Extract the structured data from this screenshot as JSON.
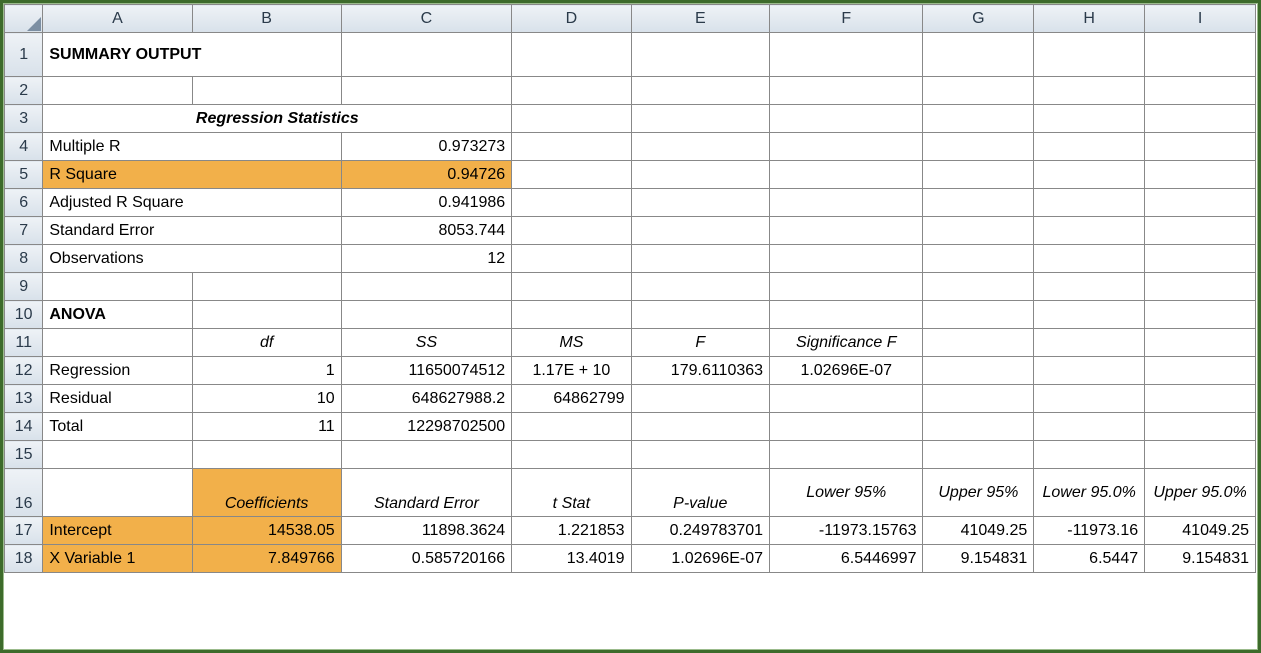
{
  "columns": [
    "A",
    "B",
    "C",
    "D",
    "E",
    "F",
    "G",
    "H",
    "I"
  ],
  "row_numbers": [
    "1",
    "2",
    "3",
    "4",
    "5",
    "6",
    "7",
    "8",
    "9",
    "10",
    "11",
    "12",
    "13",
    "14",
    "15",
    "16",
    "17",
    "18"
  ],
  "r1": {
    "A": "SUMMARY OUTPUT"
  },
  "r3": {
    "title": "Regression Statistics"
  },
  "r4": {
    "A": "Multiple R",
    "C": "0.973273"
  },
  "r5": {
    "A": "R Square",
    "C": "0.94726"
  },
  "r6": {
    "A": "Adjusted R Square",
    "C": "0.941986"
  },
  "r7": {
    "A": "Standard Error",
    "C": "8053.744"
  },
  "r8": {
    "A": "Observations",
    "C": "12"
  },
  "r10": {
    "A": "ANOVA"
  },
  "r11": {
    "B": "df",
    "C": "SS",
    "D": "MS",
    "E": "F",
    "F": "Significance F"
  },
  "r12": {
    "A": "Regression",
    "B": "1",
    "C": "11650074512",
    "D": "1.17E + 10",
    "E": "179.6110363",
    "F": "1.02696E-07"
  },
  "r13": {
    "A": "Residual",
    "B": "10",
    "C": "648627988.2",
    "D": "64862799"
  },
  "r14": {
    "A": "Total",
    "B": "11",
    "C": "12298702500"
  },
  "r16": {
    "B": "Coefficients",
    "C": "Standard Error",
    "D": "t Stat",
    "E": "P-value",
    "F": "Lower 95%",
    "G": "Upper 95%",
    "H": "Lower 95.0%",
    "I": "Upper 95.0%"
  },
  "r17": {
    "A": "Intercept",
    "B": "14538.05",
    "C": "11898.3624",
    "D": "1.221853",
    "E": "0.249783701",
    "F": "-11973.15763",
    "G": "41049.25",
    "H": "-11973.16",
    "I": "41049.25"
  },
  "r18": {
    "A": "X Variable 1",
    "B": "7.849766",
    "C": "0.585720166",
    "D": "13.4019",
    "E": "1.02696E-07",
    "F": "6.5446997",
    "G": "9.154831",
    "H": "6.5447",
    "I": "9.154831"
  },
  "chart_data": {
    "type": "table",
    "title": "SUMMARY OUTPUT",
    "regression_statistics": {
      "Multiple R": 0.973273,
      "R Square": 0.94726,
      "Adjusted R Square": 0.941986,
      "Standard Error": 8053.744,
      "Observations": 12
    },
    "anova": {
      "columns": [
        "df",
        "SS",
        "MS",
        "F",
        "Significance F"
      ],
      "rows": {
        "Regression": [
          1,
          11650074512,
          11700000000.0,
          179.6110363,
          1.02696e-07
        ],
        "Residual": [
          10,
          648627988.2,
          64862799,
          null,
          null
        ],
        "Total": [
          11,
          12298702500,
          null,
          null,
          null
        ]
      }
    },
    "coefficients": {
      "columns": [
        "Coefficients",
        "Standard Error",
        "t Stat",
        "P-value",
        "Lower 95%",
        "Upper 95%",
        "Lower 95.0%",
        "Upper 95.0%"
      ],
      "rows": {
        "Intercept": [
          14538.05,
          11898.3624,
          1.221853,
          0.249783701,
          -11973.15763,
          41049.25,
          -11973.16,
          41049.25
        ],
        "X Variable 1": [
          7.849766,
          0.585720166,
          13.4019,
          1.02696e-07,
          6.5446997,
          9.154831,
          6.5447,
          9.154831
        ]
      }
    }
  }
}
